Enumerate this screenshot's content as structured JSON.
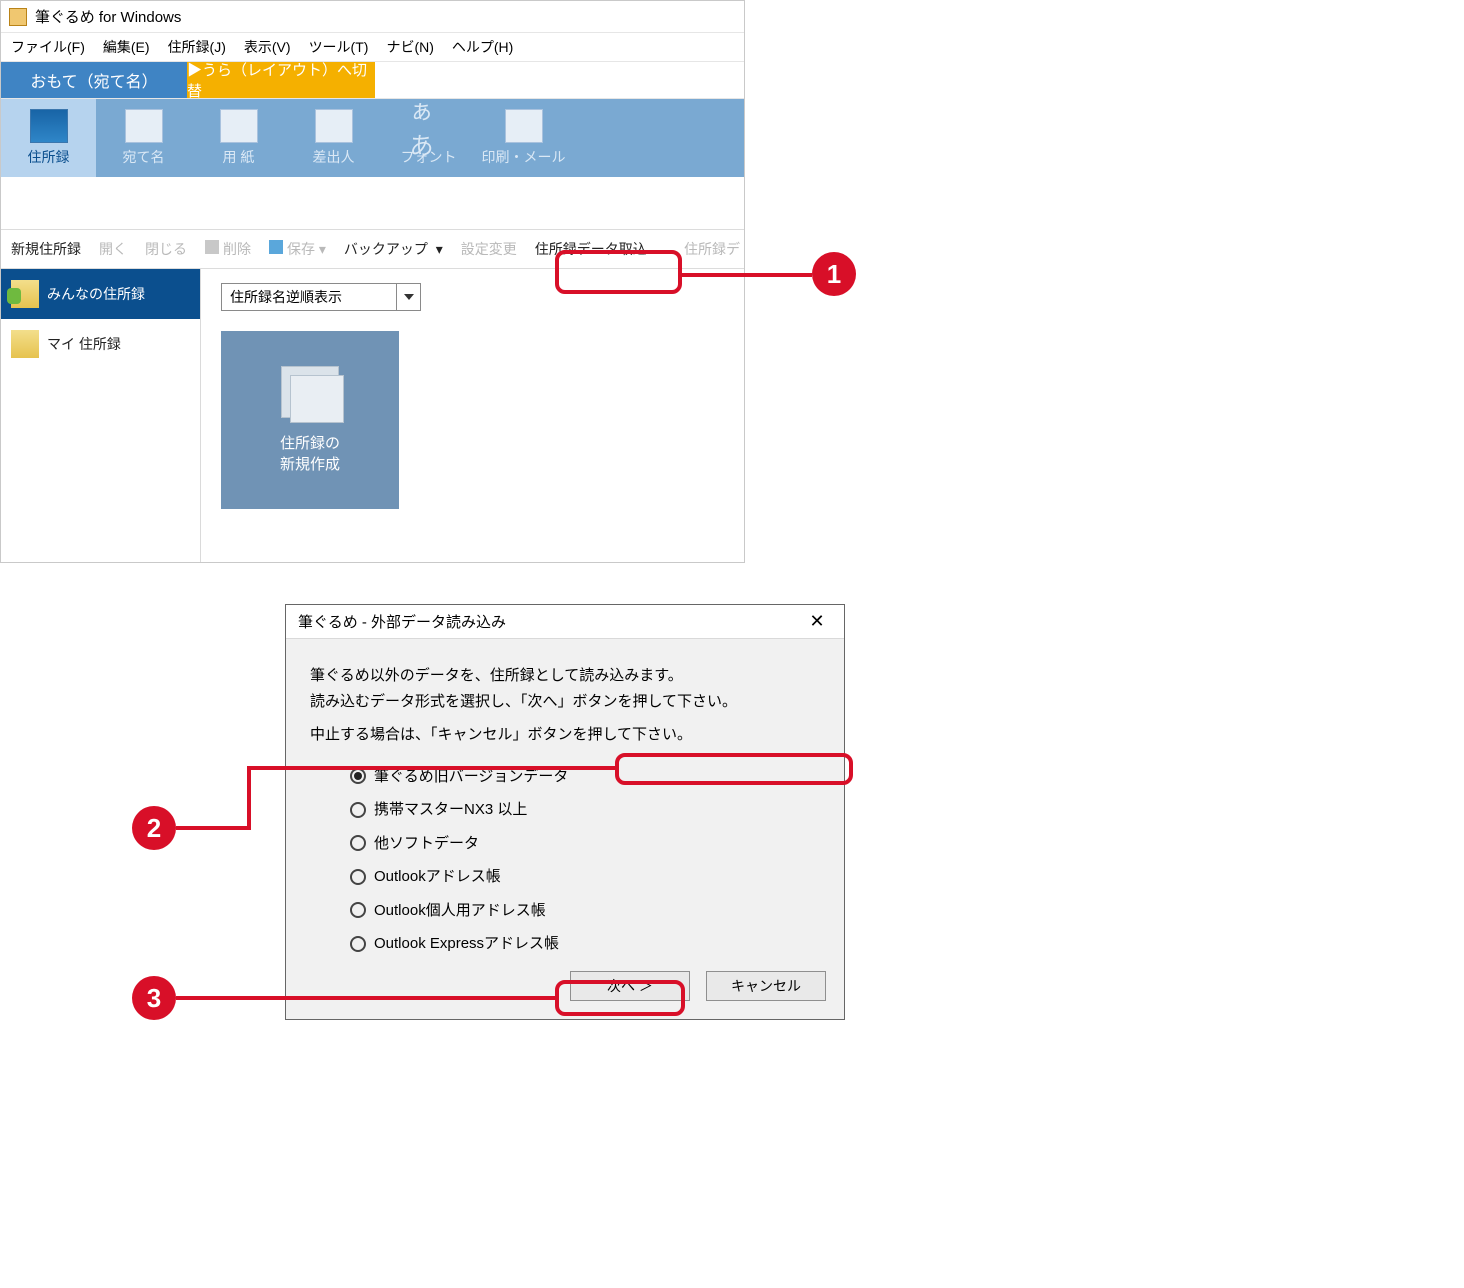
{
  "window": {
    "title": "筆ぐるめ for Windows",
    "menu": [
      "ファイル(F)",
      "編集(E)",
      "住所録(J)",
      "表示(V)",
      "ツール(T)",
      "ナビ(N)",
      "ヘルプ(H)"
    ],
    "tabs": {
      "omote": "おもて（宛て名）",
      "ura": "▶うら（レイアウト）へ切替"
    },
    "ribbon": [
      {
        "label": "住所録",
        "active": true,
        "name": "addressbook"
      },
      {
        "label": "宛て名",
        "name": "atena"
      },
      {
        "label": "用 紙",
        "name": "paper"
      },
      {
        "label": "差出人",
        "name": "sender"
      },
      {
        "label": "フォント",
        "name": "font"
      },
      {
        "label": "印刷・メール",
        "name": "print"
      }
    ],
    "toolbar2": {
      "new": "新規住所録",
      "open": "開く",
      "close": "閉じる",
      "delete": "削除",
      "save": "保存",
      "backup": "バックアップ",
      "settings": "設定変更",
      "import": "住所録データ取込",
      "import_trailing": "住所録デ"
    },
    "sidebar": [
      {
        "label": "みんなの住所録",
        "name": "everyone",
        "selected": true
      },
      {
        "label": "マイ 住所録",
        "name": "my",
        "selected": false
      }
    ],
    "dropdown": "住所録名逆順表示",
    "card": {
      "line1": "住所録の",
      "line2": "新規作成"
    }
  },
  "dialog": {
    "title": "筆ぐるめ - 外部データ読み込み",
    "desc1": "筆ぐるめ以外のデータを、住所録として読み込みます。",
    "desc2": "読み込むデータ形式を選択し、「次へ」ボタンを押して下さい。",
    "desc3": "中止する場合は、「キャンセル」ボタンを押して下さい。",
    "options": [
      "筆ぐるめ旧バージョンデータ",
      "携帯マスターNX3 以上",
      "他ソフトデータ",
      "Outlookアドレス帳",
      "Outlook個人用アドレス帳",
      "Outlook Expressアドレス帳"
    ],
    "next": "次へ ＞",
    "cancel": "キャンセル"
  },
  "markers": {
    "m1": "1",
    "m2": "2",
    "m3": "3"
  },
  "colors": {
    "accent_red": "#d80f28",
    "ribbon_blue": "#7aa9d2",
    "ribbon_active": "#b6d3ee",
    "tab_blue": "#3f84c4",
    "tab_yellow": "#f5b000",
    "side_selected": "#0b4f8e",
    "card_blue": "#7093b5"
  }
}
